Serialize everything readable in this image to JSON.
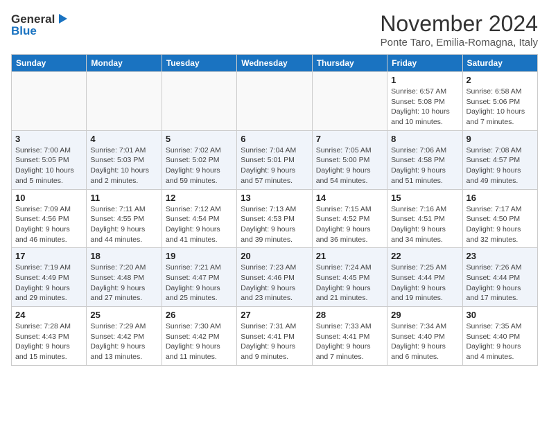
{
  "logo": {
    "line1": "General",
    "line2": "Blue"
  },
  "title": "November 2024",
  "subtitle": "Ponte Taro, Emilia-Romagna, Italy",
  "weekdays": [
    "Sunday",
    "Monday",
    "Tuesday",
    "Wednesday",
    "Thursday",
    "Friday",
    "Saturday"
  ],
  "weeks": [
    [
      {
        "day": "",
        "info": ""
      },
      {
        "day": "",
        "info": ""
      },
      {
        "day": "",
        "info": ""
      },
      {
        "day": "",
        "info": ""
      },
      {
        "day": "",
        "info": ""
      },
      {
        "day": "1",
        "info": "Sunrise: 6:57 AM\nSunset: 5:08 PM\nDaylight: 10 hours and 10 minutes."
      },
      {
        "day": "2",
        "info": "Sunrise: 6:58 AM\nSunset: 5:06 PM\nDaylight: 10 hours and 7 minutes."
      }
    ],
    [
      {
        "day": "3",
        "info": "Sunrise: 7:00 AM\nSunset: 5:05 PM\nDaylight: 10 hours and 5 minutes."
      },
      {
        "day": "4",
        "info": "Sunrise: 7:01 AM\nSunset: 5:03 PM\nDaylight: 10 hours and 2 minutes."
      },
      {
        "day": "5",
        "info": "Sunrise: 7:02 AM\nSunset: 5:02 PM\nDaylight: 9 hours and 59 minutes."
      },
      {
        "day": "6",
        "info": "Sunrise: 7:04 AM\nSunset: 5:01 PM\nDaylight: 9 hours and 57 minutes."
      },
      {
        "day": "7",
        "info": "Sunrise: 7:05 AM\nSunset: 5:00 PM\nDaylight: 9 hours and 54 minutes."
      },
      {
        "day": "8",
        "info": "Sunrise: 7:06 AM\nSunset: 4:58 PM\nDaylight: 9 hours and 51 minutes."
      },
      {
        "day": "9",
        "info": "Sunrise: 7:08 AM\nSunset: 4:57 PM\nDaylight: 9 hours and 49 minutes."
      }
    ],
    [
      {
        "day": "10",
        "info": "Sunrise: 7:09 AM\nSunset: 4:56 PM\nDaylight: 9 hours and 46 minutes."
      },
      {
        "day": "11",
        "info": "Sunrise: 7:11 AM\nSunset: 4:55 PM\nDaylight: 9 hours and 44 minutes."
      },
      {
        "day": "12",
        "info": "Sunrise: 7:12 AM\nSunset: 4:54 PM\nDaylight: 9 hours and 41 minutes."
      },
      {
        "day": "13",
        "info": "Sunrise: 7:13 AM\nSunset: 4:53 PM\nDaylight: 9 hours and 39 minutes."
      },
      {
        "day": "14",
        "info": "Sunrise: 7:15 AM\nSunset: 4:52 PM\nDaylight: 9 hours and 36 minutes."
      },
      {
        "day": "15",
        "info": "Sunrise: 7:16 AM\nSunset: 4:51 PM\nDaylight: 9 hours and 34 minutes."
      },
      {
        "day": "16",
        "info": "Sunrise: 7:17 AM\nSunset: 4:50 PM\nDaylight: 9 hours and 32 minutes."
      }
    ],
    [
      {
        "day": "17",
        "info": "Sunrise: 7:19 AM\nSunset: 4:49 PM\nDaylight: 9 hours and 29 minutes."
      },
      {
        "day": "18",
        "info": "Sunrise: 7:20 AM\nSunset: 4:48 PM\nDaylight: 9 hours and 27 minutes."
      },
      {
        "day": "19",
        "info": "Sunrise: 7:21 AM\nSunset: 4:47 PM\nDaylight: 9 hours and 25 minutes."
      },
      {
        "day": "20",
        "info": "Sunrise: 7:23 AM\nSunset: 4:46 PM\nDaylight: 9 hours and 23 minutes."
      },
      {
        "day": "21",
        "info": "Sunrise: 7:24 AM\nSunset: 4:45 PM\nDaylight: 9 hours and 21 minutes."
      },
      {
        "day": "22",
        "info": "Sunrise: 7:25 AM\nSunset: 4:44 PM\nDaylight: 9 hours and 19 minutes."
      },
      {
        "day": "23",
        "info": "Sunrise: 7:26 AM\nSunset: 4:44 PM\nDaylight: 9 hours and 17 minutes."
      }
    ],
    [
      {
        "day": "24",
        "info": "Sunrise: 7:28 AM\nSunset: 4:43 PM\nDaylight: 9 hours and 15 minutes."
      },
      {
        "day": "25",
        "info": "Sunrise: 7:29 AM\nSunset: 4:42 PM\nDaylight: 9 hours and 13 minutes."
      },
      {
        "day": "26",
        "info": "Sunrise: 7:30 AM\nSunset: 4:42 PM\nDaylight: 9 hours and 11 minutes."
      },
      {
        "day": "27",
        "info": "Sunrise: 7:31 AM\nSunset: 4:41 PM\nDaylight: 9 hours and 9 minutes."
      },
      {
        "day": "28",
        "info": "Sunrise: 7:33 AM\nSunset: 4:41 PM\nDaylight: 9 hours and 7 minutes."
      },
      {
        "day": "29",
        "info": "Sunrise: 7:34 AM\nSunset: 4:40 PM\nDaylight: 9 hours and 6 minutes."
      },
      {
        "day": "30",
        "info": "Sunrise: 7:35 AM\nSunset: 4:40 PM\nDaylight: 9 hours and 4 minutes."
      }
    ]
  ]
}
